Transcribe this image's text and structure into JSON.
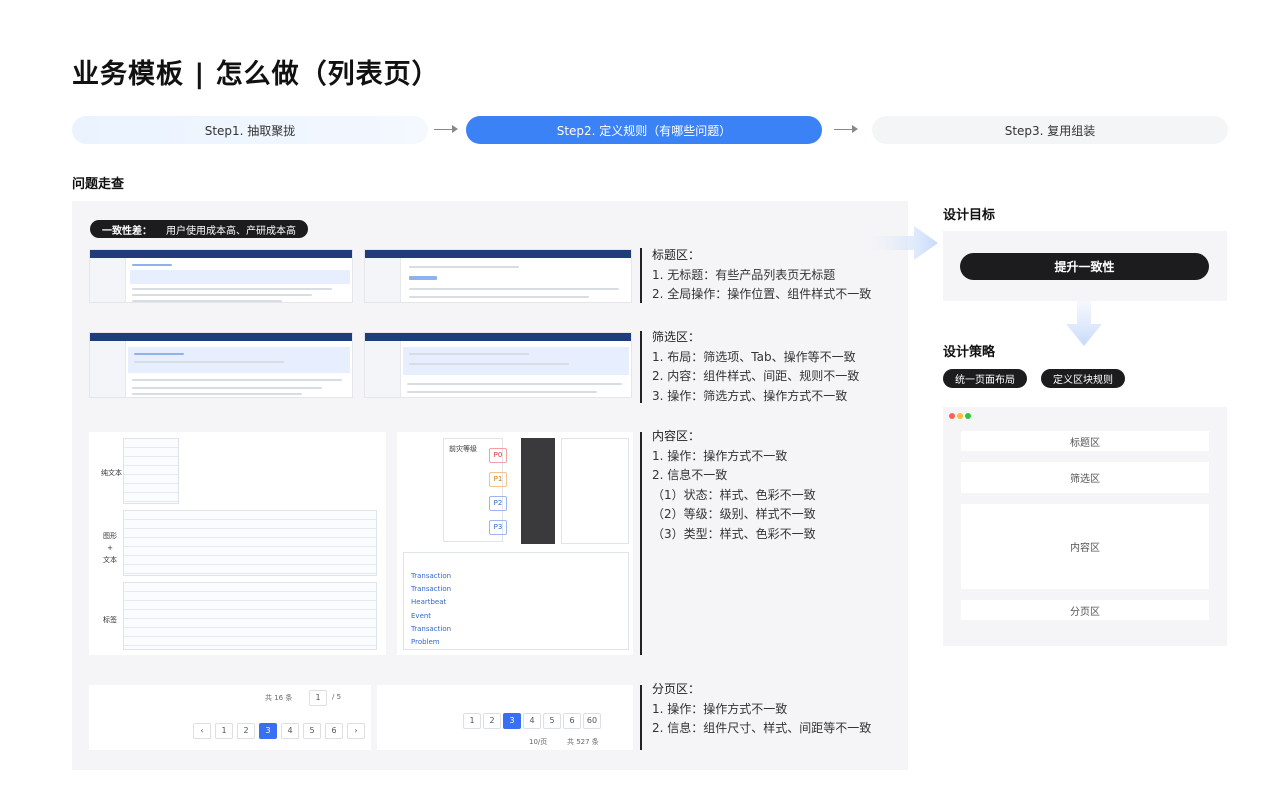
{
  "page": {
    "title": "业务模板 | 怎么做（列表页）"
  },
  "steps": [
    {
      "label": "Step1. 抽取聚拢"
    },
    {
      "label": "Step2. 定义规则（有哪些问题）"
    },
    {
      "label": "Step3. 复用组装"
    }
  ],
  "audit": {
    "section_title": "问题走查",
    "badge": {
      "label": "一致性差：",
      "text": "用户使用成本高、产研成本高"
    },
    "groups": [
      {
        "title": "标题区：",
        "lines": [
          "1. 无标题：有些产品列表页无标题",
          "2. 全局操作：操作位置、组件样式不一致"
        ]
      },
      {
        "title": "筛选区：",
        "lines": [
          "1. 布局：筛选项、Tab、操作等不一致",
          "2. 内容：组件样式、间距、规则不一致",
          "3. 操作：筛选方式、操作方式不一致"
        ]
      },
      {
        "title": "内容区：",
        "lines": [
          "1. 操作：操作方式不一致",
          "2. 信息不一致",
          "（1）状态：样式、色彩不一致",
          "（2）等级：级别、样式不一致",
          "（3）类型：样式、色彩不一致"
        ]
      },
      {
        "title": "分页区：",
        "lines": [
          "1. 操作：操作方式不一致",
          "2. 信息：组件尺寸、样式、间距等不一致"
        ]
      }
    ],
    "samples": {
      "row_labels": [
        "纯文本",
        "图形\n+\n文本",
        "标签"
      ],
      "level_title": "前灾等级",
      "levels": [
        "P0",
        "P1",
        "P2",
        "P3"
      ],
      "alarm_types": [
        "Transaction",
        "Transaction",
        "Heartbeat",
        "Event",
        "Transaction",
        "Problem"
      ],
      "pager_a": {
        "total": "共 16 条",
        "page": "1",
        "of": "/ 5",
        "pages": [
          "1",
          "2",
          "3",
          "4",
          "5",
          "6"
        ],
        "current": "3"
      },
      "pager_b": {
        "pages": [
          "1",
          "2",
          "3",
          "4",
          "5",
          "6",
          "60"
        ],
        "current": "3",
        "size": "10/页",
        "total": "共 527 条"
      }
    }
  },
  "goal": {
    "section_title": "设计目标",
    "button": "提升一致性"
  },
  "strategy": {
    "section_title": "设计策略",
    "tags": [
      "统一页面布局",
      "定义区块规则"
    ],
    "window_dots": [
      "#ff5f57",
      "#febc2e",
      "#28c840"
    ],
    "blocks": [
      "标题区",
      "筛选区",
      "内容区",
      "分页区"
    ]
  },
  "colors": {
    "accent": "#3b82f6",
    "dark": "#1c1c1e",
    "panel": "#f5f5f7"
  }
}
